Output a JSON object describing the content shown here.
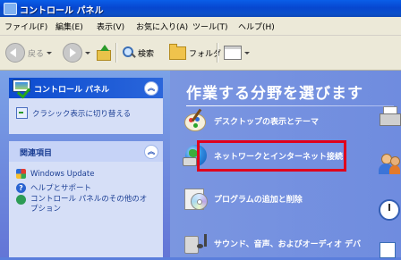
{
  "window": {
    "title": "コントロール パネル"
  },
  "menu": [
    "ファイル(F)",
    "編集(E)",
    "表示(V)",
    "お気に入り(A)",
    "ツール(T)",
    "ヘルプ(H)"
  ],
  "toolbar": {
    "back": "戻る",
    "search": "検索",
    "folders": "フォルダ"
  },
  "left": {
    "control_panel": {
      "title": "コントロール パネル",
      "switch_link": "クラシック表示に切り替える"
    },
    "related": {
      "title": "関連項目",
      "items": [
        "Windows Update",
        "ヘルプとサポート",
        "コントロール パネルのその他のオ",
        "プション"
      ]
    }
  },
  "main": {
    "heading": "作業する分野を選びます",
    "categories": [
      "デスクトップの表示とテーマ",
      "ネットワークとインターネット接続",
      "プログラムの追加と削除",
      "サウンド、音声、およびオーディオ デバ"
    ]
  },
  "colors": {
    "highlight": "#e0001b",
    "title_bar": "#0a5ee8",
    "sidebar": "#6375d6"
  }
}
